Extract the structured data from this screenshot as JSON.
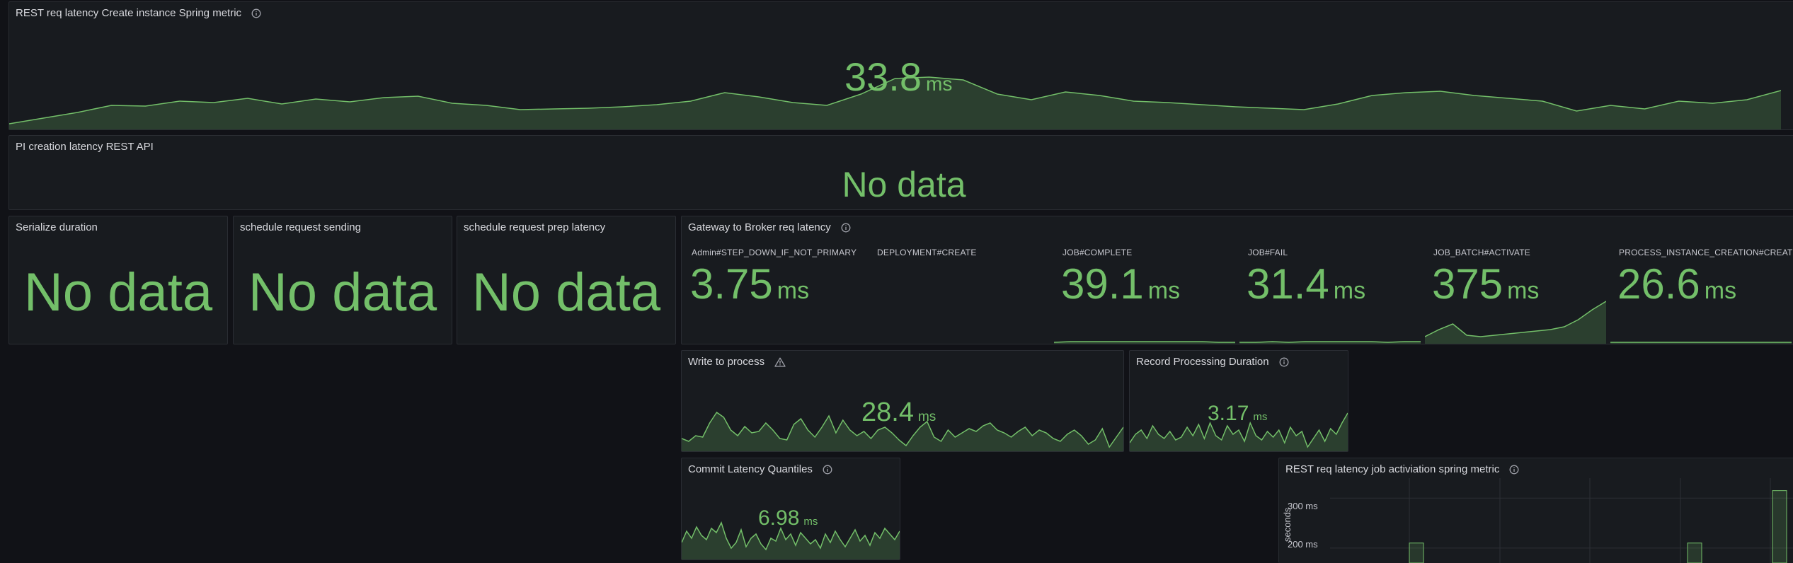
{
  "colors": {
    "value": "#73bf69",
    "panel_bg": "#181b1f",
    "page_bg": "#111217",
    "border": "#2a2d33"
  },
  "panels": {
    "rest_create": {
      "title": "REST req latency Create instance Spring metric",
      "value": "33.8",
      "unit": "ms",
      "icon": "info-icon",
      "spark": [
        8,
        16,
        24,
        34,
        33,
        40,
        38,
        44,
        36,
        43,
        39,
        45,
        47,
        37,
        34,
        28,
        29,
        30,
        32,
        35,
        40,
        52,
        46,
        38,
        34,
        50,
        72,
        74,
        70,
        50,
        42,
        53,
        48,
        40,
        38,
        35,
        32,
        30,
        28,
        36,
        48,
        52,
        54,
        48,
        44,
        40,
        26,
        34,
        29,
        40,
        37,
        42,
        55
      ]
    },
    "pi_creation": {
      "title": "PI creation latency REST API",
      "value": "No data"
    },
    "serialize": {
      "title": "Serialize duration",
      "value": "No data"
    },
    "schedule_sending": {
      "title": "schedule request sending",
      "value": "No data"
    },
    "schedule_prep": {
      "title": "schedule request prep latency",
      "value": "No data"
    },
    "gateway": {
      "title": "Gateway to Broker req latency",
      "icon": "info-icon",
      "items": [
        {
          "label": "Admin#STEP_DOWN_IF_NOT_PRIMARY",
          "value": "3.75",
          "unit": "ms",
          "spark": []
        },
        {
          "label": "DEPLOYMENT#CREATE",
          "value": "",
          "unit": "",
          "spark": []
        },
        {
          "label": "JOB#COMPLETE",
          "value": "39.1",
          "unit": "ms",
          "spark": [
            2,
            3,
            3,
            3,
            3,
            3,
            3,
            3,
            3,
            3,
            2,
            2
          ]
        },
        {
          "label": "JOB#FAIL",
          "value": "31.4",
          "unit": "ms",
          "spark": [
            2,
            2,
            3,
            2,
            3,
            3,
            3,
            3,
            3,
            2,
            3,
            3
          ]
        },
        {
          "label": "JOB_BATCH#ACTIVATE",
          "value": "375",
          "unit": "ms",
          "spark": [
            10,
            20,
            28,
            12,
            10,
            12,
            14,
            16,
            18,
            20,
            24,
            34,
            48,
            60
          ]
        },
        {
          "label": "PROCESS_INSTANCE_CREATION#CREATE",
          "value": "26.6",
          "unit": "ms",
          "spark": [
            2,
            2,
            2,
            2,
            2,
            2,
            2,
            2,
            2,
            2
          ]
        }
      ]
    },
    "write_to_process": {
      "title": "Write to process",
      "icon": "warn-icon",
      "value": "28.4",
      "unit": "ms",
      "spark": [
        18,
        14,
        22,
        20,
        40,
        55,
        48,
        30,
        22,
        35,
        26,
        28,
        40,
        30,
        18,
        16,
        38,
        46,
        30,
        20,
        34,
        50,
        26,
        44,
        30,
        22,
        28,
        18,
        30,
        34,
        26,
        16,
        8,
        22,
        34,
        42,
        20,
        14,
        30,
        20,
        26,
        32,
        28,
        36,
        40,
        30,
        26,
        20,
        28,
        34,
        22,
        30,
        26,
        18,
        14,
        24,
        30,
        22,
        10,
        16,
        32,
        6,
        20,
        34
      ]
    },
    "record_processing": {
      "title": "Record Processing Duration",
      "icon": "info-icon",
      "value": "3.17",
      "unit": "ms",
      "spark": [
        12,
        24,
        30,
        18,
        36,
        24,
        18,
        28,
        16,
        20,
        34,
        22,
        38,
        18,
        40,
        22,
        16,
        36,
        24,
        30,
        14,
        40,
        22,
        16,
        28,
        20,
        30,
        12,
        34,
        22,
        28,
        6,
        18,
        30,
        14,
        32,
        24,
        40,
        54
      ]
    },
    "commit_latency": {
      "title": "Commit Latency Quantiles",
      "icon": "info-icon",
      "value": "6.98",
      "unit": "ms",
      "spark": [
        24,
        40,
        30,
        46,
        34,
        28,
        44,
        38,
        52,
        30,
        16,
        24,
        42,
        18,
        30,
        36,
        22,
        14,
        30,
        26,
        44,
        28,
        36,
        20,
        38,
        30,
        22,
        28,
        16,
        36,
        24,
        40,
        28,
        18,
        30,
        42,
        26,
        34,
        20,
        38,
        30,
        44,
        36,
        28,
        40
      ]
    },
    "rest_job_activation": {
      "title": "REST req latency job activiation spring metric",
      "icon": "info-icon",
      "axis": {
        "ylabel": "seconds",
        "ticks": [
          "300 ms",
          "200 ms"
        ]
      }
    }
  },
  "chart_data": {
    "type": "bar",
    "title": "REST req latency job activiation spring metric",
    "xlabel": "",
    "ylabel": "seconds",
    "ylim_visible": [
      170,
      340
    ],
    "yticks": [
      "300 ms",
      "200 ms"
    ],
    "grid": true,
    "bars_ms": [
      210,
      210,
      315
    ]
  }
}
